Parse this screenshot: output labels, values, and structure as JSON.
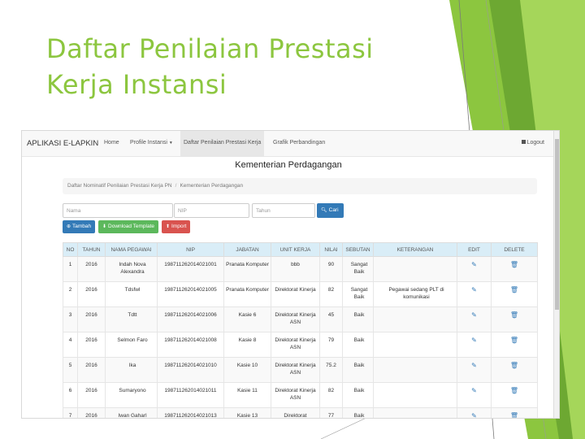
{
  "slide": {
    "title": "Daftar Penilaian Prestasi Kerja Instansi",
    "accent_color": "#8cc63f"
  },
  "app": {
    "brand": "APLIKASI E-LAPKIN",
    "nav": [
      {
        "label": "Home"
      },
      {
        "label": "Profile Instansi",
        "dropdown": true
      },
      {
        "label": "Daftar Penilaian Prestasi Kerja",
        "active": true
      },
      {
        "label": "Grafik Perbandingan"
      }
    ],
    "logout_label": "Logout",
    "org_title": "Kementerian Perdagangan",
    "breadcrumb": [
      "Daftar Nominatif Penilaian Prestasi Kerja PN",
      "Kementerian Perdagangan"
    ],
    "search": {
      "name_placeholder": "Nama",
      "nip_placeholder": "NIP",
      "year_placeholder": "Tahun",
      "search_label": "Cari"
    },
    "actions": {
      "add_label": "Tambah",
      "download_label": "Download Template",
      "import_label": "Import"
    },
    "table": {
      "headers": [
        "NO",
        "TAHUN",
        "NAMA PEGAWAI",
        "NIP",
        "JABATAN",
        "UNIT KERJA",
        "NILAI",
        "SEBUTAN",
        "KETERANGAN",
        "EDIT",
        "DELETE"
      ],
      "rows": [
        {
          "no": "1",
          "year": "2016",
          "name": "Indah Nova Alexandra",
          "nip": "198711262014021001",
          "position": "Pranata Komputer",
          "unit": "bbb",
          "score": "90",
          "predicate": "Sangat Baik",
          "note": ""
        },
        {
          "no": "2",
          "year": "2016",
          "name": "Tdsfwl",
          "nip": "198711262014021005",
          "position": "Pranata Komputer",
          "unit": "Direktorat Kinerja",
          "score": "82",
          "predicate": "Sangat Baik",
          "note": "Pegawai sedang PLT di komunikasi"
        },
        {
          "no": "3",
          "year": "2016",
          "name": "Tdtt",
          "nip": "198711262014021006",
          "position": "Kasie 6",
          "unit": "Direktorat Kinerja ASN",
          "score": "45",
          "predicate": "Baik",
          "note": ""
        },
        {
          "no": "4",
          "year": "2016",
          "name": "Selmon Faro",
          "nip": "198711262014021008",
          "position": "Kasie 8",
          "unit": "Direktorat Kinerja ASN",
          "score": "79",
          "predicate": "Baik",
          "note": ""
        },
        {
          "no": "5",
          "year": "2016",
          "name": "Ika",
          "nip": "198711262014021010",
          "position": "Kasie 10",
          "unit": "Direktorat Kinerja ASN",
          "score": "75.2",
          "predicate": "Baik",
          "note": ""
        },
        {
          "no": "6",
          "year": "2016",
          "name": "Sumaryono",
          "nip": "198711262014021011",
          "position": "Kasie 11",
          "unit": "Direktorat Kinerja ASN",
          "score": "82",
          "predicate": "Baik",
          "note": ""
        },
        {
          "no": "7",
          "year": "2016",
          "name": "Iwan Gaharl",
          "nip": "198711262014021013",
          "position": "Kasie 13",
          "unit": "Direktorat",
          "score": "77",
          "predicate": "Baik",
          "note": ""
        }
      ]
    }
  }
}
